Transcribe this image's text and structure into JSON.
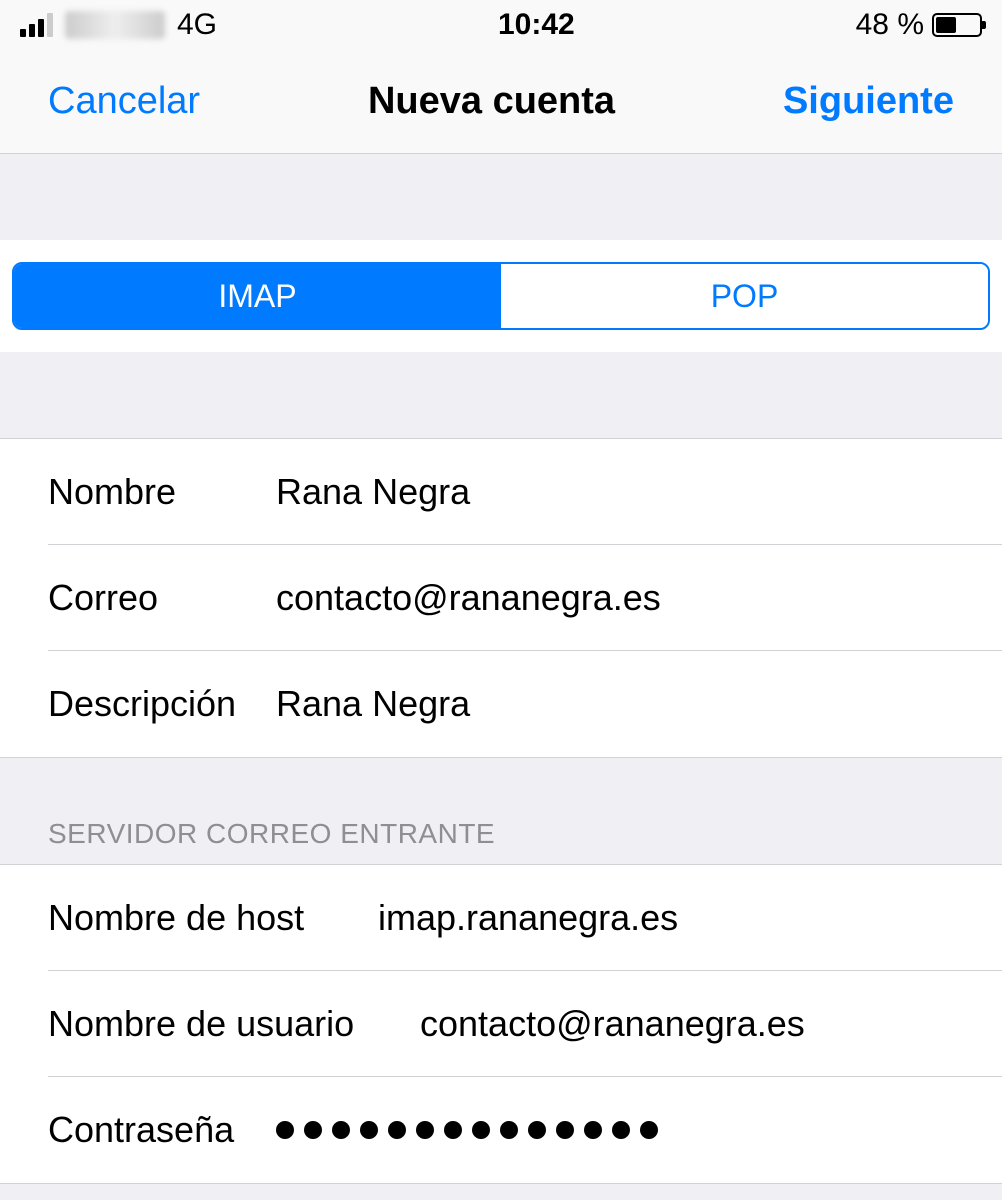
{
  "status_bar": {
    "network_type": "4G",
    "time": "10:42",
    "battery_percent": "48 %"
  },
  "nav": {
    "cancel": "Cancelar",
    "title": "Nueva cuenta",
    "next": "Siguiente"
  },
  "segments": {
    "imap": "IMAP",
    "pop": "POP"
  },
  "account": {
    "name_label": "Nombre",
    "name_value": "Rana Negra",
    "email_label": "Correo",
    "email_value": "contacto@rananegra.es",
    "description_label": "Descripción",
    "description_value": "Rana Negra"
  },
  "incoming": {
    "header": "SERVIDOR CORREO ENTRANTE",
    "host_label": "Nombre de host",
    "host_value": "imap.rananegra.es",
    "user_label": "Nombre de usuario",
    "user_value": "contacto@rananegra.es",
    "password_label": "Contraseña"
  }
}
